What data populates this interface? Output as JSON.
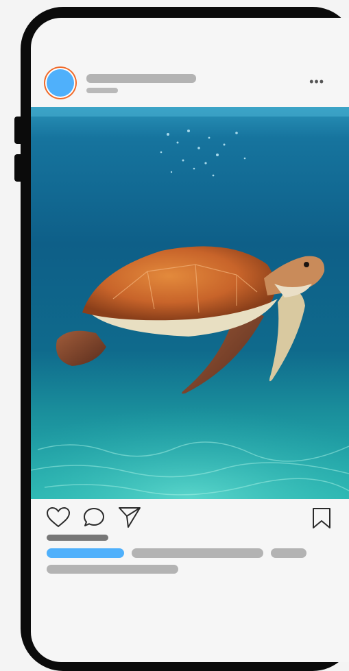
{
  "post": {
    "image_subject": "sea-turtle",
    "more_label": "•••"
  },
  "colors": {
    "avatar": "#4fb0fb",
    "avatar_ring": "#f06a2a",
    "placeholder": "#b3b3b3",
    "placeholder_dark": "#777777",
    "accent_bar": "#4fb0fb",
    "frame": "#0b0b0b"
  },
  "icons": [
    "heart-icon",
    "comment-icon",
    "share-icon",
    "bookmark-icon",
    "more-icon"
  ]
}
